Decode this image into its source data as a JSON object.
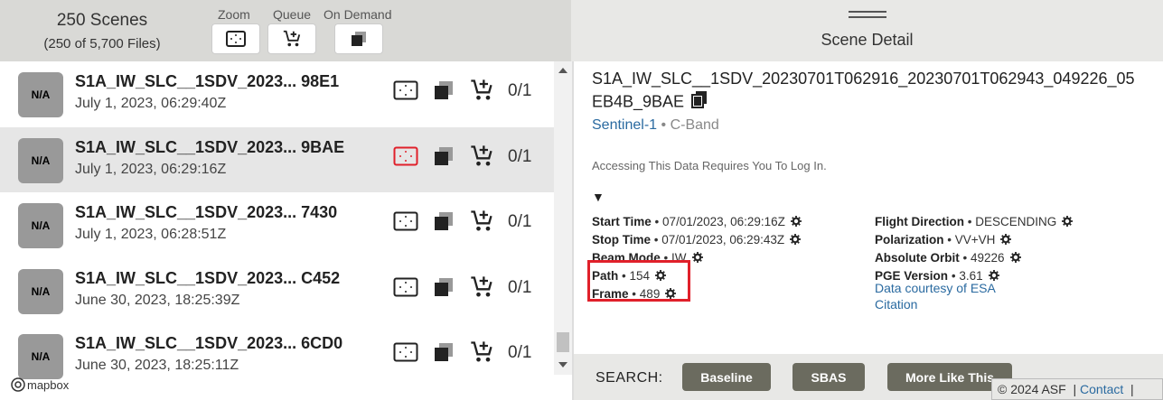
{
  "header": {
    "scenes_title": "250 Scenes",
    "scenes_sub": "(250 of 5,700 Files)",
    "zoom_label": "Zoom",
    "queue_label": "Queue",
    "on_demand_label": "On Demand",
    "detail_title": "Scene Detail"
  },
  "scenes": [
    {
      "thumb": "N/A",
      "name": "S1A_IW_SLC__1SDV_2023... 98E1",
      "date": "July 1, 2023, 06:29:40Z",
      "count": "0/1",
      "selected": false
    },
    {
      "thumb": "N/A",
      "name": "S1A_IW_SLC__1SDV_2023... 9BAE",
      "date": "July 1, 2023, 06:29:16Z",
      "count": "0/1",
      "selected": true
    },
    {
      "thumb": "N/A",
      "name": "S1A_IW_SLC__1SDV_2023... 7430",
      "date": "July 1, 2023, 06:28:51Z",
      "count": "0/1",
      "selected": false
    },
    {
      "thumb": "N/A",
      "name": "S1A_IW_SLC__1SDV_2023... C452",
      "date": "June 30, 2023, 18:25:39Z",
      "count": "0/1",
      "selected": false
    },
    {
      "thumb": "N/A",
      "name": "S1A_IW_SLC__1SDV_2023... 6CD0",
      "date": "June 30, 2023, 18:25:11Z",
      "count": "0/1",
      "selected": false
    }
  ],
  "detail": {
    "title": "S1A_IW_SLC__1SDV_20230701T062916_20230701T062943_049226_05EB4B_9BAE",
    "dataset": "Sentinel-1",
    "band": "C-Band",
    "login_note": "Accessing This Data Requires You To Log In.",
    "caret": "▼",
    "left_meta": [
      {
        "label": "Start Time",
        "value": "07/01/2023, 06:29:16Z"
      },
      {
        "label": "Stop Time",
        "value": "07/01/2023, 06:29:43Z"
      },
      {
        "label": "Beam Mode",
        "value": "IW"
      },
      {
        "label": "Path",
        "value": "154"
      },
      {
        "label": "Frame",
        "value": "489"
      }
    ],
    "right_meta": [
      {
        "label": "Flight Direction",
        "value": "DESCENDING"
      },
      {
        "label": "Polarization",
        "value": "VV+VH"
      },
      {
        "label": "Absolute Orbit",
        "value": "49226"
      },
      {
        "label": "PGE Version",
        "value": "3.61"
      }
    ],
    "links": [
      "Data courtesy of ESA",
      "Citation"
    ],
    "separator": "•"
  },
  "footer": {
    "search_label": "SEARCH:",
    "buttons": [
      "Baseline",
      "SBAS",
      "More Like This"
    ],
    "copyright": "© 2024 ASF",
    "contact": "Contact",
    "sep": "|"
  },
  "map": {
    "attribution": "mapbox"
  },
  "colors": {
    "highlight": "#e0202a",
    "link": "#2a6aa0",
    "button": "#6b6b5f"
  }
}
